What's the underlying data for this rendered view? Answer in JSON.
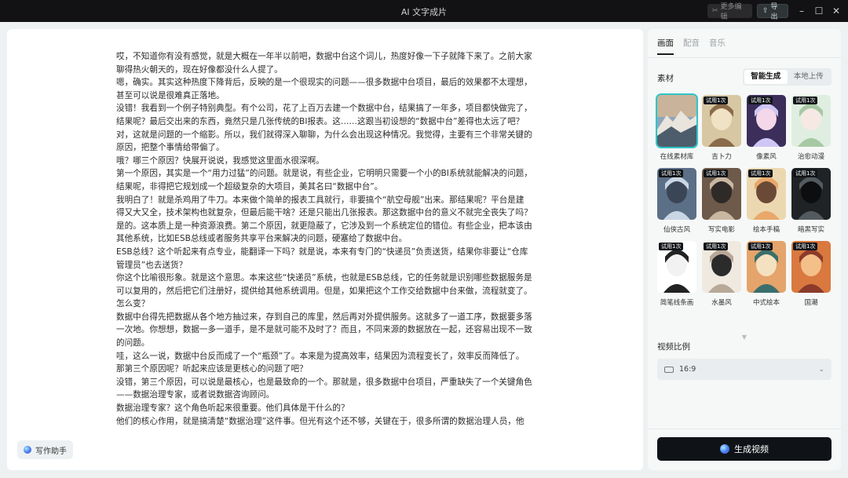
{
  "window": {
    "title": "AI 文字成片",
    "more_edit": "更多编辑",
    "export": "导出"
  },
  "editor": {
    "paragraphs": [
      "哎，不知道你有没有感觉，就是大概在一年半以前吧，数据中台这个词儿，热度好像一下子就降下来了。之前大家聊得热火朝天的，现在好像都没什么人提了。",
      "嗯，确实。其实这种热度下降背后，反映的是一个很现实的问题——很多数据中台项目，最后的效果都不太理想，甚至可以说是很难真正落地。",
      "没错！我看到一个例子特别典型。有个公司，花了上百万去建一个数据中台，结果搞了一年多，项目都快做完了，结果呢？最后交出来的东西，竟然只是几张传统的BI报表。这……这跟当初设想的“数据中台”差得也太远了吧？",
      "对，这就是问题的一个缩影。所以，我们就得深入聊聊，为什么会出现这种情况。我觉得，主要有三个非常关键的原因，把整个事情给带偏了。",
      "哦？哪三个原因？快展开说说，我感觉这里面水很深啊。",
      "第一个原因，其实是一个“用力过猛”的问题。就是说，有些企业，它明明只需要一个小的BI系统就能解决的问题，结果呢，非得把它规划成一个超级复杂的大项目，美其名曰“数据中台”。",
      "我明白了！就是杀鸡用了牛刀。本来做个简单的报表工具就行，非要搞个“航空母舰”出来。那结果呢？平台是建得又大又全，技术架构也就复杂，但最后能干啥？还是只能出几张报表。那这数据中台的意义不就完全丧失了吗？",
      "是的。这本质上是一种资源浪费。第二个原因，就更隐蔽了，它涉及到一个系统定位的错位。有些企业，把本该由其他系统，比如ESB总线或者服务共享平台来解决的问题，硬塞给了数据中台。",
      "ESB总线？这个听起来有点专业，能翻译一下吗？就是说，本来有专门的“快递员”负责送货，结果你非要让“仓库管理员”也去送货？",
      "你这个比喻很形象。就是这个意思。本来这些“快递员”系统，也就是ESB总线，它的任务就是识别哪些数据服务是可以复用的，然后把它们注册好，提供给其他系统调用。但是，如果把这个工作交给数据中台来做，流程就变了。",
      "怎么变？",
      "数据中台得先把数据从各个地方抽过来，存到自己的库里，然后再对外提供服务。这就多了一道工序，数据要多落一次地。你想想，数据一多一道手，是不是就可能不及时了？而且，不同来源的数据放在一起，还容易出现不一致的问题。",
      "哇，这么一说，数据中台反而成了一个“瓶颈”了。本来是为提高效率，结果因为流程变长了，效率反而降低了。那第三个原因呢？听起来应该是更核心的问题了吧？",
      "没错，第三个原因，可以说是最核心，也是最致命的一个。那就是，很多数据中台项目，严重缺失了一个关键角色——数据治理专家，或者说数据咨询顾问。",
      "数据治理专家？这个角色听起来很重要。他们具体是干什么的？",
      "他们的核心作用，就是搞清楚“数据治理”这件事。但光有这个还不够，关键在于，很多所谓的数据治理人员，他"
    ],
    "assistant_label": "写作助手"
  },
  "side": {
    "tabs": [
      "画面",
      "配音",
      "音乐"
    ],
    "active_tab": 0,
    "material_label": "素材",
    "modes": [
      "智能生成",
      "本地上传"
    ],
    "active_mode": 0,
    "trial_badge": "试用1次",
    "styles": [
      {
        "name": "在线素材库",
        "trial": false,
        "selected": true
      },
      {
        "name": "吉卜力",
        "trial": true
      },
      {
        "name": "像素风",
        "trial": true
      },
      {
        "name": "治愈动漫",
        "trial": true
      },
      {
        "name": "仙侠古风",
        "trial": true
      },
      {
        "name": "写实电影",
        "trial": true
      },
      {
        "name": "绘本手稿",
        "trial": true
      },
      {
        "name": "暗黑写实",
        "trial": true
      },
      {
        "name": "简笔线条画",
        "trial": true
      },
      {
        "name": "水墨风",
        "trial": true
      },
      {
        "name": "中式绘本",
        "trial": true
      },
      {
        "name": "国潮",
        "trial": true
      }
    ],
    "ratio_label": "视频比例",
    "ratio_value": "16:9",
    "generate_label": "生成视频"
  },
  "colors": {
    "accent": "#2fc5c9",
    "generate_bg": "#0f1317"
  }
}
